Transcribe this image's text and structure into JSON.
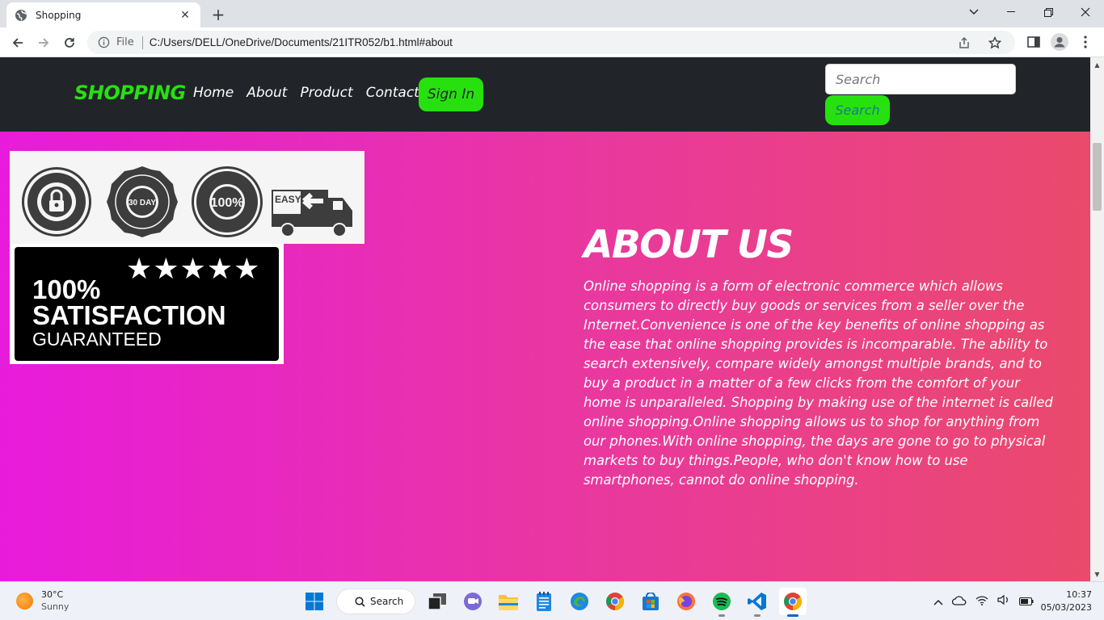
{
  "browser": {
    "tab_title": "Shopping",
    "scheme_label": "File",
    "url": "C:/Users/DELL/OneDrive/Documents/21ITR052/b1.html#about"
  },
  "site": {
    "brand": "SHOPPING",
    "nav": [
      "Home",
      "About",
      "Product",
      "Contact"
    ],
    "signin_label": "Sign In",
    "search_placeholder": "Search",
    "search_button": "Search",
    "badges": [
      "SECURE ORDERING",
      "MONEY-BACK 30 DAY GUARANTEE",
      "SATISFACTION 100% GUARANTEED",
      "EASY RETURNS"
    ],
    "guarantee": {
      "line1": "100%",
      "line2": "SATISFACTION",
      "line3": "GUARANTEED",
      "stars": "★★★★★"
    },
    "about_title": "ABOUT US",
    "about_text": "Online shopping is a form of electronic commerce which allows consumers to directly buy goods or services from a seller over the Internet.Convenience is one of the key benefits of online shopping as the ease that online shopping provides is incomparable. The ability to search extensively, compare widely amongst multiple brands, and to buy a product in a matter of a few clicks from the comfort of your home is unparalleled. Shopping by making use of the internet is called online shopping.Online shopping allows us to shop for anything from our phones.With online shopping, the days are gone to go to physical markets to buy things.People, who don't know how to use smartphones, cannot do online shopping."
  },
  "taskbar": {
    "weather_temp": "30°C",
    "weather_desc": "Sunny",
    "search_label": "Search",
    "time": "10:37",
    "date": "05/03/2023"
  },
  "colors": {
    "accent_green": "#27e10f",
    "nav_bg": "#212529",
    "gradient_start": "#e81bdc",
    "gradient_end": "#ea4a6c"
  }
}
